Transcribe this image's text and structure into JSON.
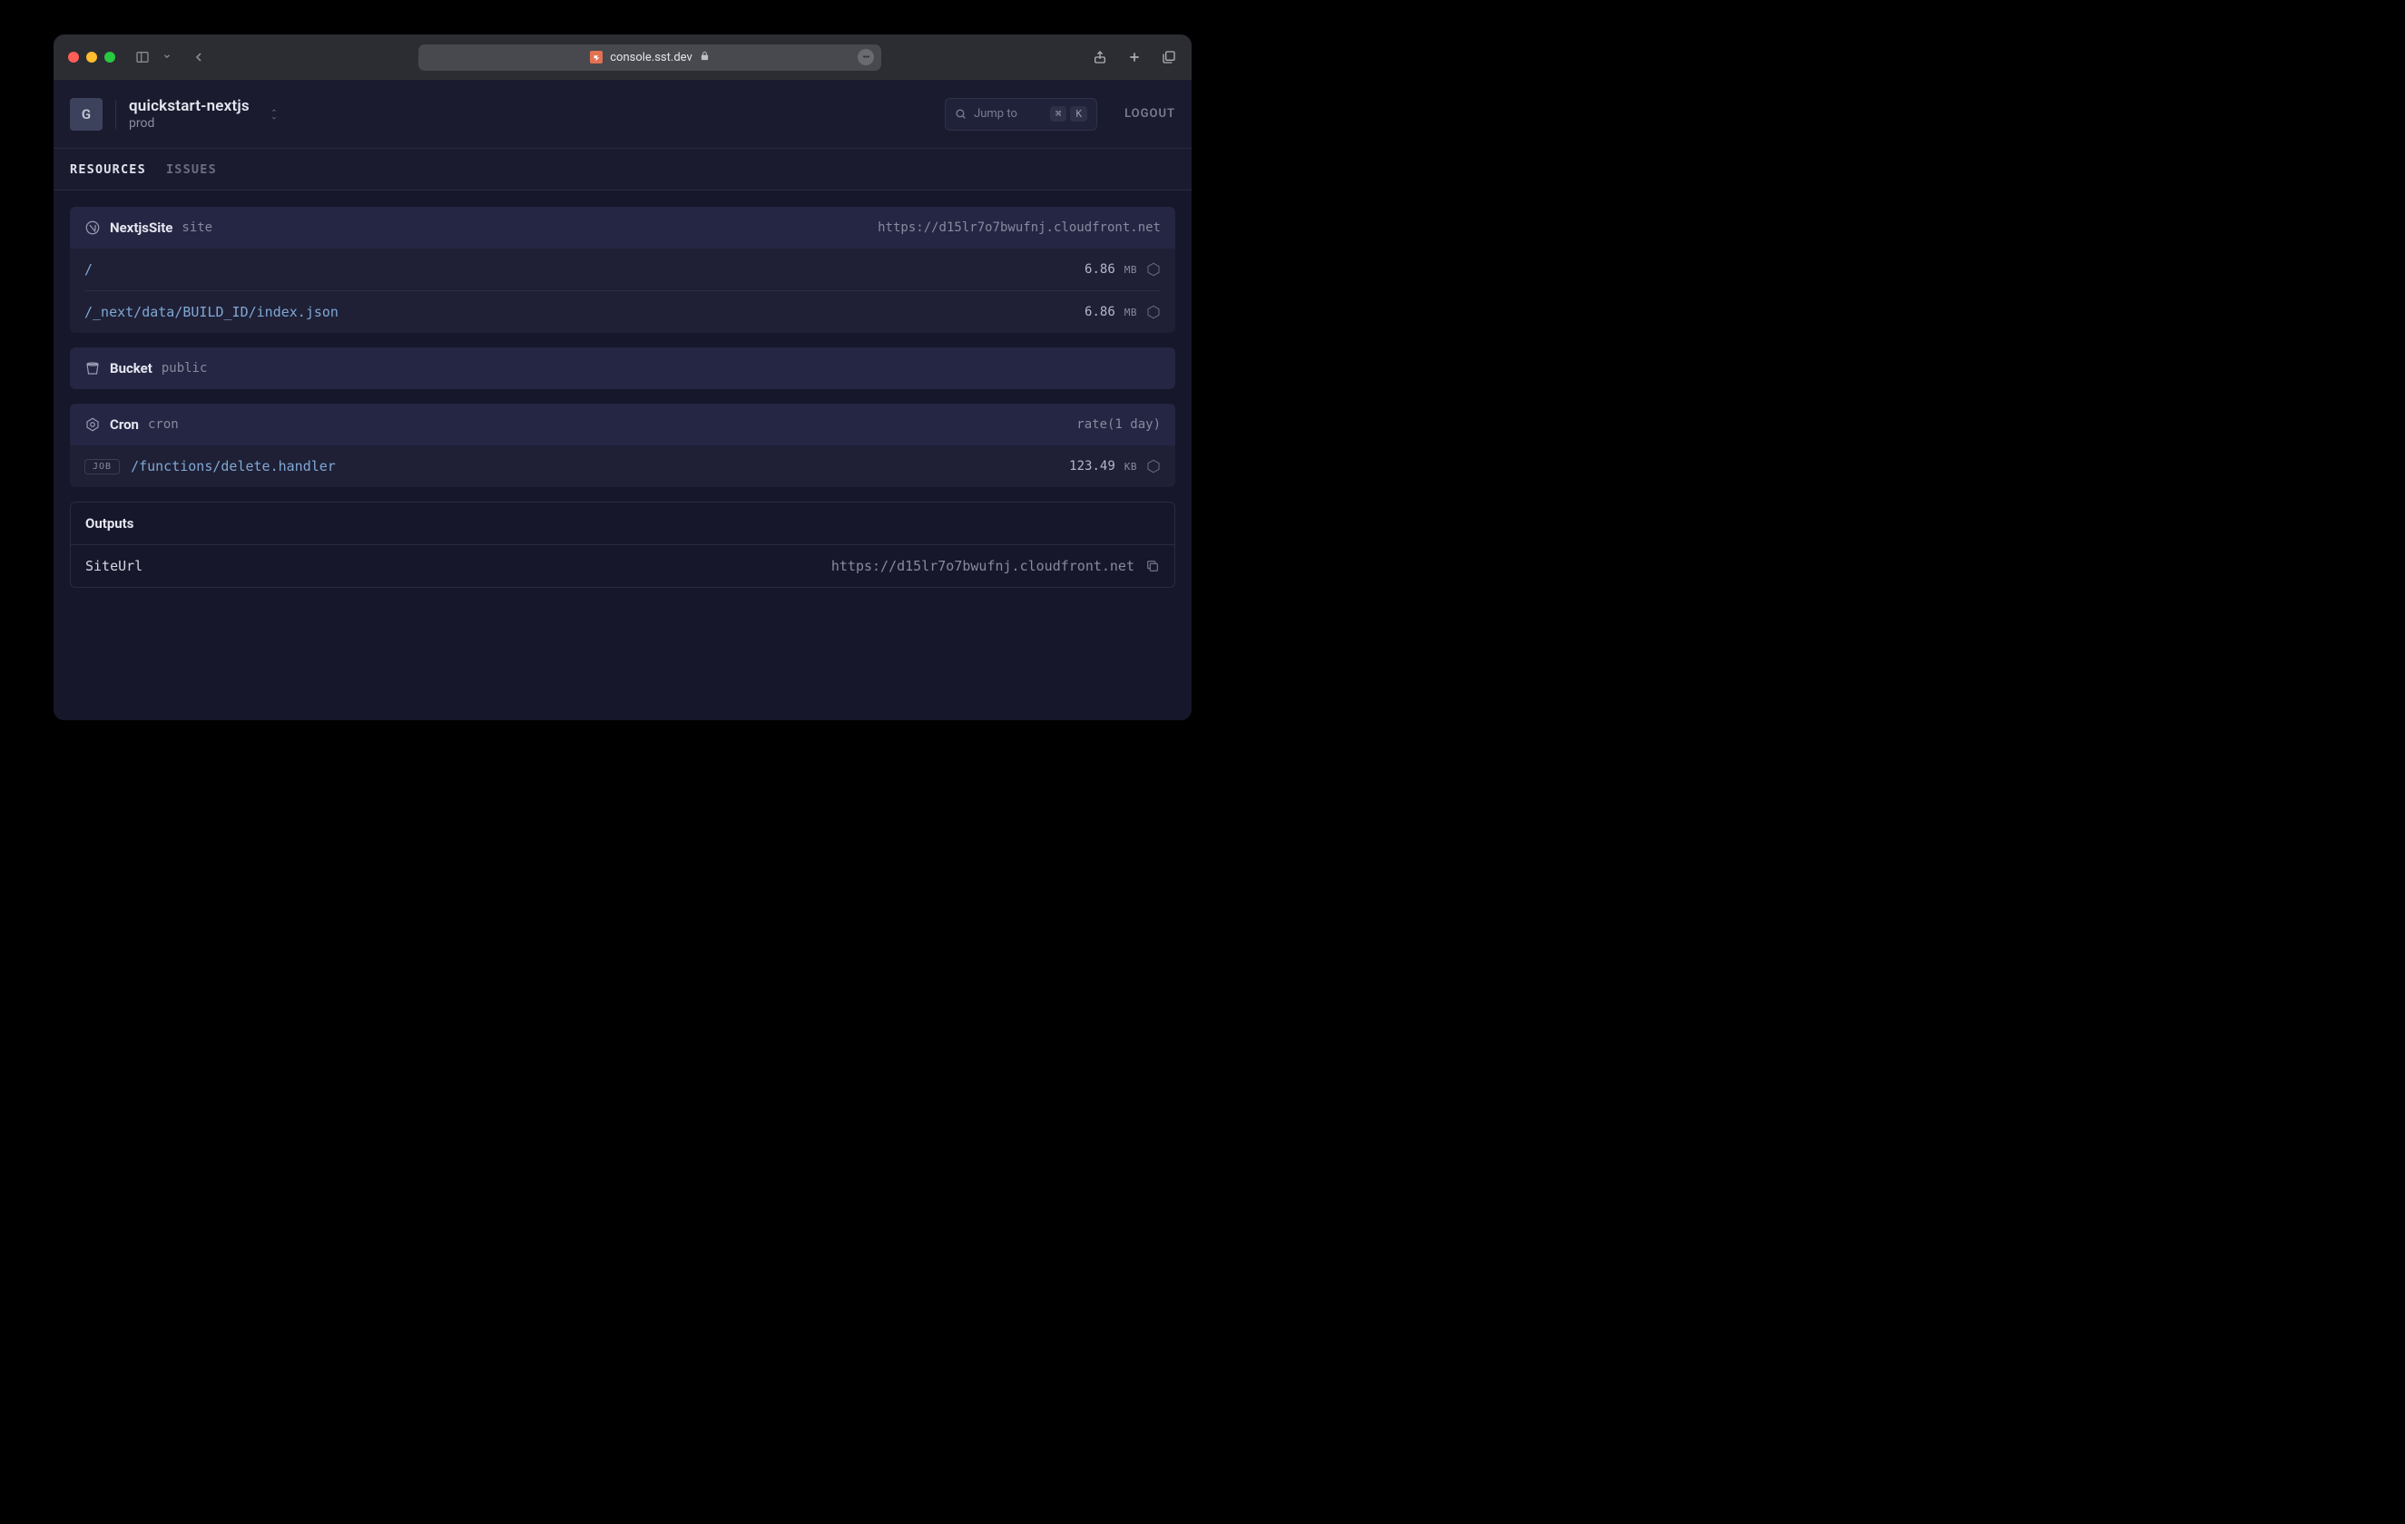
{
  "browser": {
    "url": "console.sst.dev"
  },
  "header": {
    "org_letter": "G",
    "project_name": "quickstart-nextjs",
    "stage": "prod",
    "jump_label": "Jump to",
    "kbd_cmd": "⌘",
    "kbd_k": "K",
    "logout": "LOGOUT"
  },
  "tabs": {
    "resources": "RESOURCES",
    "issues": "ISSUES"
  },
  "resources": [
    {
      "type": "NextjsSite",
      "name": "site",
      "right": "https://d15lr7o7bwufnj.cloudfront.net",
      "rows": [
        {
          "path": "/",
          "size_val": "6.86",
          "size_unit": "MB"
        },
        {
          "path": "/_next/data/BUILD_ID/index.json",
          "size_val": "6.86",
          "size_unit": "MB"
        }
      ]
    },
    {
      "type": "Bucket",
      "name": "public",
      "right": "",
      "rows": []
    },
    {
      "type": "Cron",
      "name": "cron",
      "right": "rate(1 day)",
      "rows": [
        {
          "badge": "JOB",
          "path": "/functions/delete.handler",
          "size_val": "123.49",
          "size_unit": "KB"
        }
      ]
    }
  ],
  "outputs": {
    "title": "Outputs",
    "items": [
      {
        "key": "SiteUrl",
        "value": "https://d15lr7o7bwufnj.cloudfront.net"
      }
    ]
  }
}
